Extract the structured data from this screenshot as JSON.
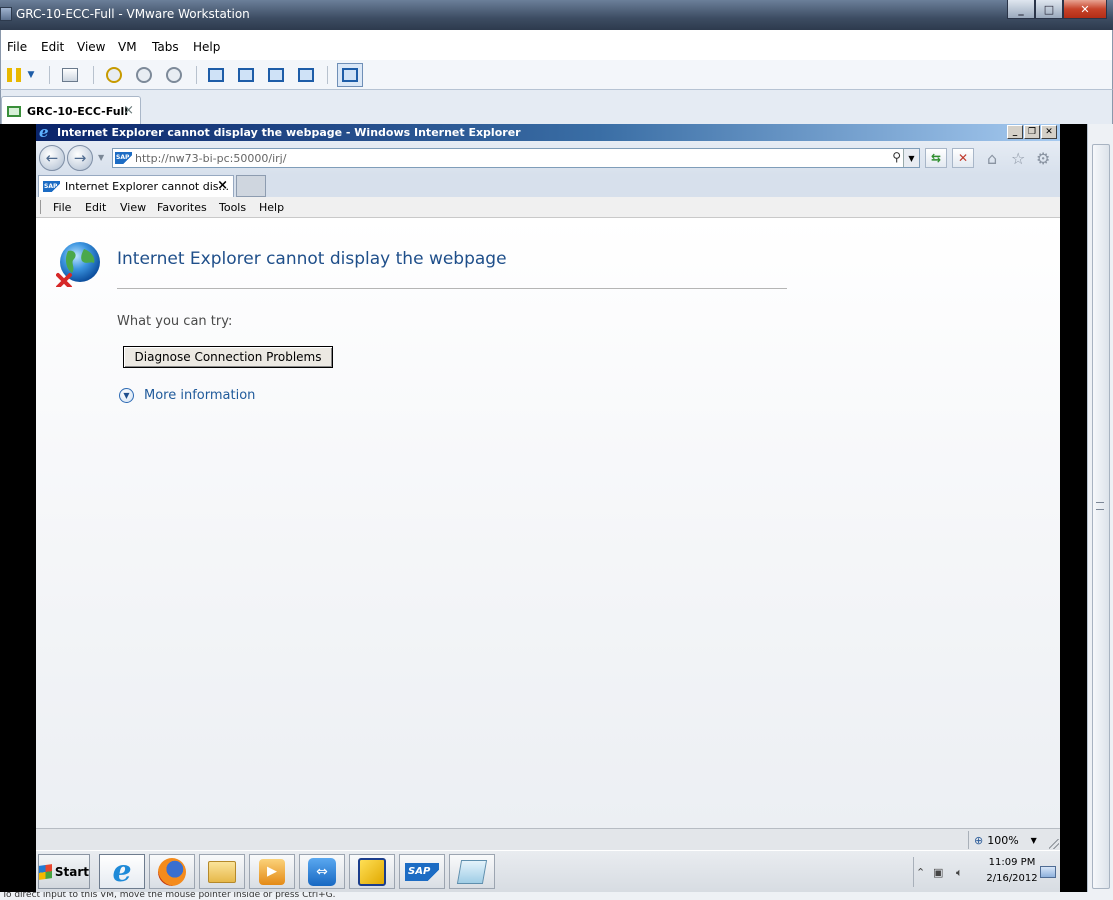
{
  "vmware": {
    "window_title": "GRC-10-ECC-Full - VMware Workstation",
    "menu": [
      "File",
      "Edit",
      "View",
      "VM",
      "Tabs",
      "Help"
    ],
    "tab_label": "GRC-10-ECC-Full",
    "tab_close": "×",
    "status_text": "To direct input to this VM, move the mouse pointer inside or press Ctrl+G."
  },
  "ie": {
    "window_title": "Internet Explorer cannot display the webpage - Windows Internet Explorer",
    "address_url": "http://nw73-bi-pc:50000/irj/",
    "tab_label": "Internet Explorer cannot dis...",
    "tab_close": "×",
    "menu": [
      "File",
      "Edit",
      "View",
      "Favorites",
      "Tools",
      "Help"
    ],
    "content": {
      "heading": "Internet Explorer cannot display the webpage",
      "try_label": "What you can try:",
      "diagnose_button": "Diagnose Connection Problems",
      "more_info": "More information"
    },
    "zoom": "100%"
  },
  "taskbar": {
    "start_label": "Start",
    "sap_label": "SAP",
    "time": "11:09 PM",
    "date": "2/16/2012"
  },
  "colors": {
    "ie_heading": "#1f4f8a",
    "link": "#1f5a9b",
    "vmware_titlebar": "#3d4d63"
  }
}
